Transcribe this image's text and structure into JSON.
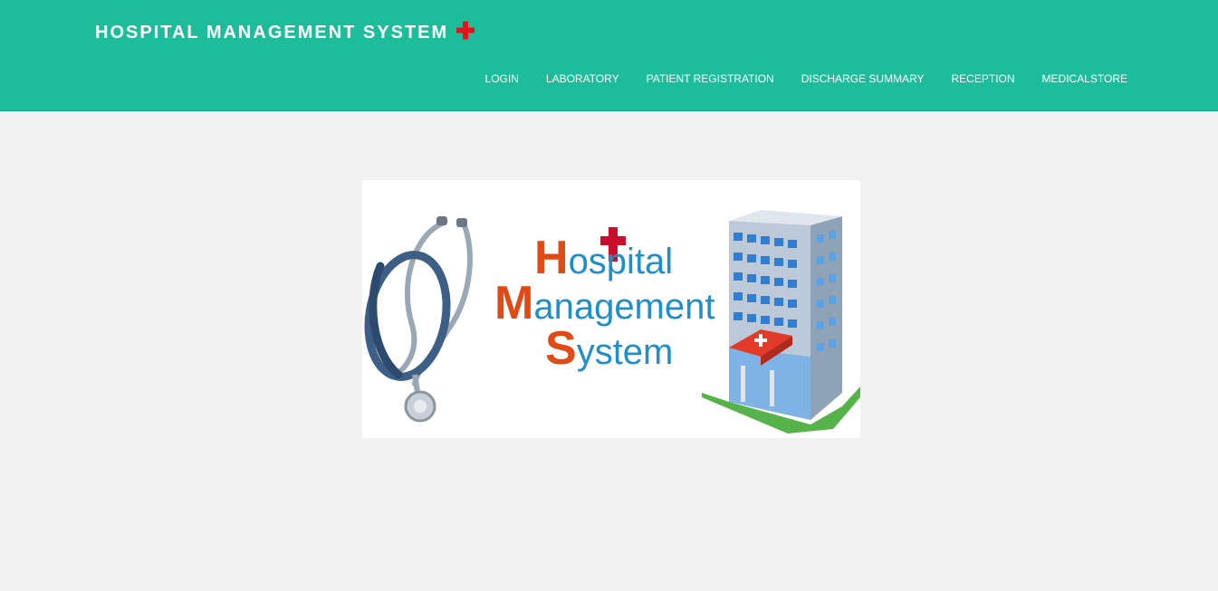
{
  "header": {
    "brand": "HOSPITAL MANAGEMENT SYSTEM",
    "brand_icon": "red-cross-icon",
    "nav": [
      {
        "label": "LOGIN"
      },
      {
        "label": "LABORATORY"
      },
      {
        "label": "PATIENT REGISTRATION"
      },
      {
        "label": "DISCHARGE SUMMARY"
      },
      {
        "label": "RECEPTION"
      },
      {
        "label": "MEDICALSTORE"
      }
    ]
  },
  "banner": {
    "line1_initial": "H",
    "line1_rest": "ospital",
    "line2_initial": "M",
    "line2_rest": "anagement",
    "line3_initial": "S",
    "line3_rest": "ystem",
    "accent_orange": "#e04a14",
    "accent_blue": "#1f8fc9",
    "cross_color": "#c8102e"
  },
  "colors": {
    "header_bg": "#1dbd9b",
    "page_bg": "#f1f1f1"
  }
}
